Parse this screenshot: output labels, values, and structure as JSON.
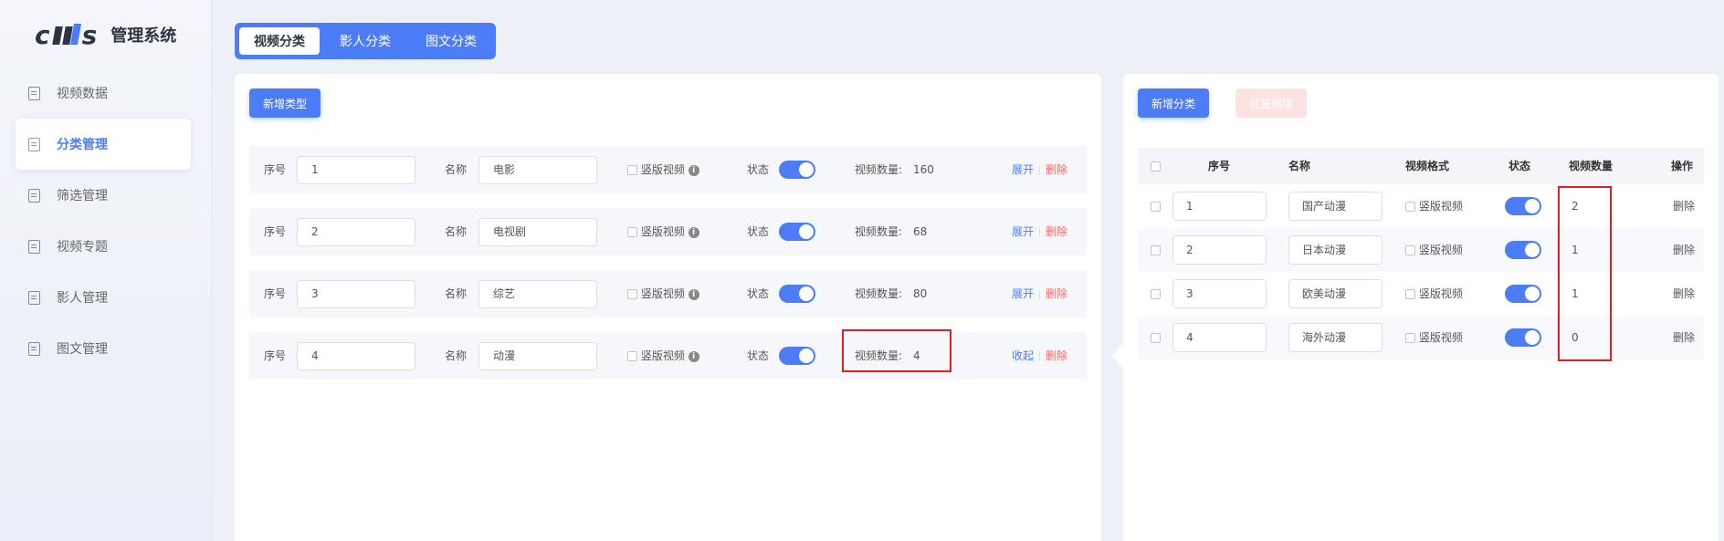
{
  "app": {
    "logo_text": "cms",
    "title": "管理系统"
  },
  "sidebar": {
    "items": [
      {
        "label": "视频数据",
        "active": false
      },
      {
        "label": "分类管理",
        "active": true
      },
      {
        "label": "筛选管理",
        "active": false
      },
      {
        "label": "视频专题",
        "active": false
      },
      {
        "label": "影人管理",
        "active": false
      },
      {
        "label": "图文管理",
        "active": false
      }
    ]
  },
  "tabs": [
    {
      "label": "视频分类",
      "active": true
    },
    {
      "label": "影人分类",
      "active": false
    },
    {
      "label": "图文分类",
      "active": false
    }
  ],
  "left_panel": {
    "add_button": "新增类型",
    "labels": {
      "order": "序号",
      "name": "名称",
      "vertical": "竖版视频",
      "status": "状态",
      "count": "视频数量:"
    },
    "rows": [
      {
        "order": "1",
        "name": "电影",
        "count": "160",
        "action": "展开",
        "delete": "删除"
      },
      {
        "order": "2",
        "name": "电视剧",
        "count": "68",
        "action": "展开",
        "delete": "删除"
      },
      {
        "order": "3",
        "name": "综艺",
        "count": "80",
        "action": "展开",
        "delete": "删除"
      },
      {
        "order": "4",
        "name": "动漫",
        "count": "4",
        "action": "收起",
        "delete": "删除"
      }
    ]
  },
  "right_panel": {
    "add_button": "新增分类",
    "batch_delete_button": "批量删除",
    "columns": [
      "序号",
      "名称",
      "视频格式",
      "状态",
      "视频数量",
      "操作"
    ],
    "vertical_label": "竖版视频",
    "rows": [
      {
        "order": "1",
        "name": "国产动漫",
        "count": "2",
        "delete": "删除"
      },
      {
        "order": "2",
        "name": "日本动漫",
        "count": "1",
        "delete": "删除"
      },
      {
        "order": "3",
        "name": "欧美动漫",
        "count": "1",
        "delete": "删除"
      },
      {
        "order": "4",
        "name": "海外动漫",
        "count": "0",
        "delete": "删除"
      }
    ]
  },
  "colors": {
    "accent": "#4c7cf6",
    "danger": "#f56c6c",
    "highlight": "#e41e1e"
  }
}
